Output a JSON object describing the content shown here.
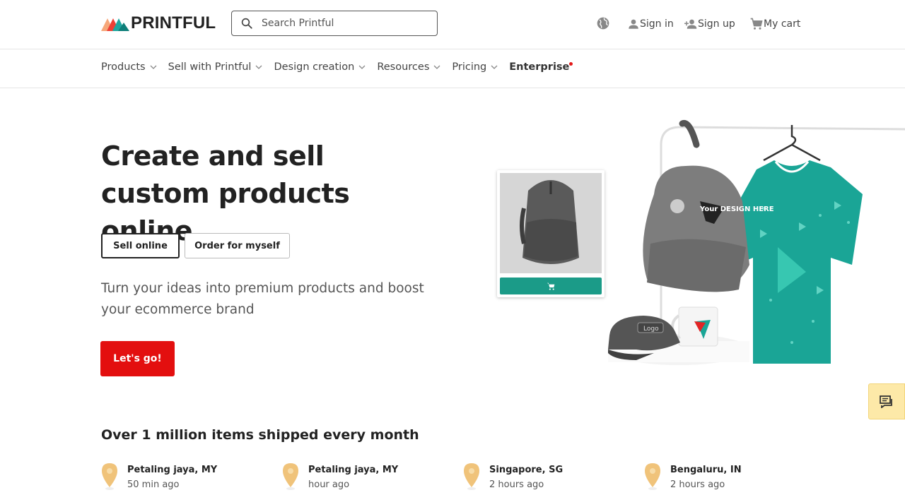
{
  "header": {
    "logo_text": "PRINTFUL",
    "search": {
      "placeholder": "Search Printful",
      "value": ""
    },
    "sign_in": "Sign in",
    "sign_up": "Sign up",
    "cart": "My cart"
  },
  "nav": {
    "items": [
      {
        "label": "Products",
        "has_dropdown": true
      },
      {
        "label": "Sell with Printful",
        "has_dropdown": true
      },
      {
        "label": "Design creation",
        "has_dropdown": true
      },
      {
        "label": "Resources",
        "has_dropdown": true
      },
      {
        "label": "Pricing",
        "has_dropdown": true
      },
      {
        "label": "Enterprise",
        "has_dropdown": false,
        "badge": "red-dot"
      }
    ]
  },
  "hero": {
    "title": "Create and sell custom products online",
    "toggle_sell": "Sell online",
    "toggle_order": "Order for myself",
    "subtitle": "Turn your ideas into premium products and boost your ecommerce brand",
    "cta": "Let's go!",
    "art": {
      "backpack_print": "Your DESIGN HERE",
      "cap_print": "Logo"
    }
  },
  "shipped": {
    "title": "Over 1 million items shipped every month",
    "items": [
      {
        "city": "Petaling jaya, MY",
        "time": "50 min ago"
      },
      {
        "city": "Petaling jaya, MY",
        "time": "hour ago"
      },
      {
        "city": "Singapore, SG",
        "time": "2 hours ago"
      },
      {
        "city": "Bengaluru, IN",
        "time": "2 hours ago"
      }
    ]
  },
  "colors": {
    "brand_red": "#e30f0f",
    "teal": "#1b9b88",
    "pin": "#f0c37a",
    "chat_bg": "#fde9a8"
  }
}
